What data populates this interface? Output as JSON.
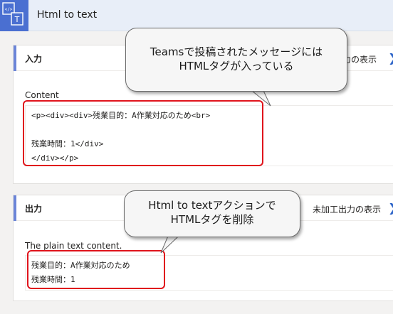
{
  "header": {
    "title": "Html to text",
    "icon": "html-to-text-icon"
  },
  "input_section": {
    "title": "入力",
    "raw_link": "未加工入力の表示",
    "raw_link_visible": "力の表示",
    "field_label": "Content",
    "content_lines": [
      "<p><div><div>残業目的：A作業対応のため<br>",
      "",
      "残業時間：1</div>",
      "</div></p>"
    ]
  },
  "output_section": {
    "title": "出力",
    "raw_link": "未加工出力の表示",
    "field_label": "The plain text content.",
    "content_lines": [
      "残業目的：A作業対応のため",
      "残業時間：1"
    ]
  },
  "callouts": {
    "top": [
      "Teamsで投稿されたメッセージには",
      "HTMLタグが入っている"
    ],
    "bottom": [
      "Html to textアクションで",
      "HTMLタグを削除"
    ]
  },
  "colors": {
    "accent": "#4a6fd1",
    "highlight": "#e0141c",
    "link": "#2b63c8"
  }
}
